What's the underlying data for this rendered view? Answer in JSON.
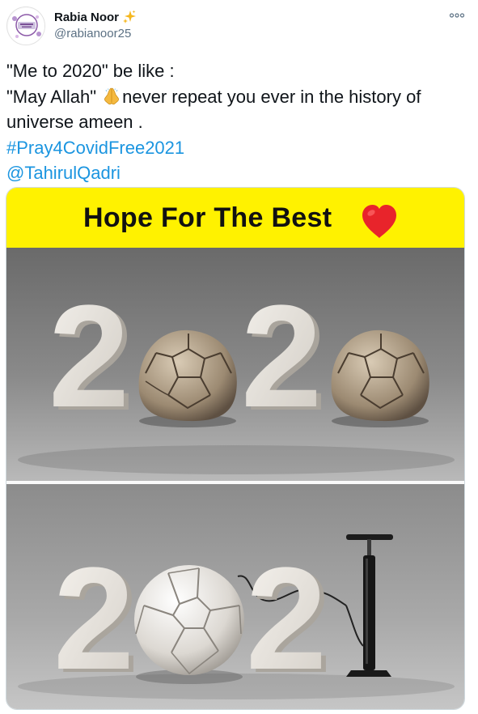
{
  "author": {
    "name": "Rabia Noor",
    "handle": "@rabianoor25",
    "name_emoji": "sparkles-icon"
  },
  "tweet": {
    "line1": "\"Me to 2020\" be like :",
    "line2_before": "\"May Allah\" ",
    "line2_after": "never repeat you ever in the history of",
    "line3": "universe  ameen .",
    "hashtag": "#Pray4CovidFree2021",
    "mention": "@TahirulQadri",
    "inline_emoji": "folded-hands-icon"
  },
  "media": {
    "banner_title": "Hope For The Best",
    "banner_emoji": "red-heart-icon",
    "top_year_digits": [
      "2",
      "2"
    ],
    "bottom_year_digits": [
      "2",
      "2"
    ]
  },
  "colors": {
    "link": "#1b95e0",
    "banner_yellow": "#fff200",
    "handle_gray": "#5b7083",
    "heart_red": "#e8242b"
  }
}
